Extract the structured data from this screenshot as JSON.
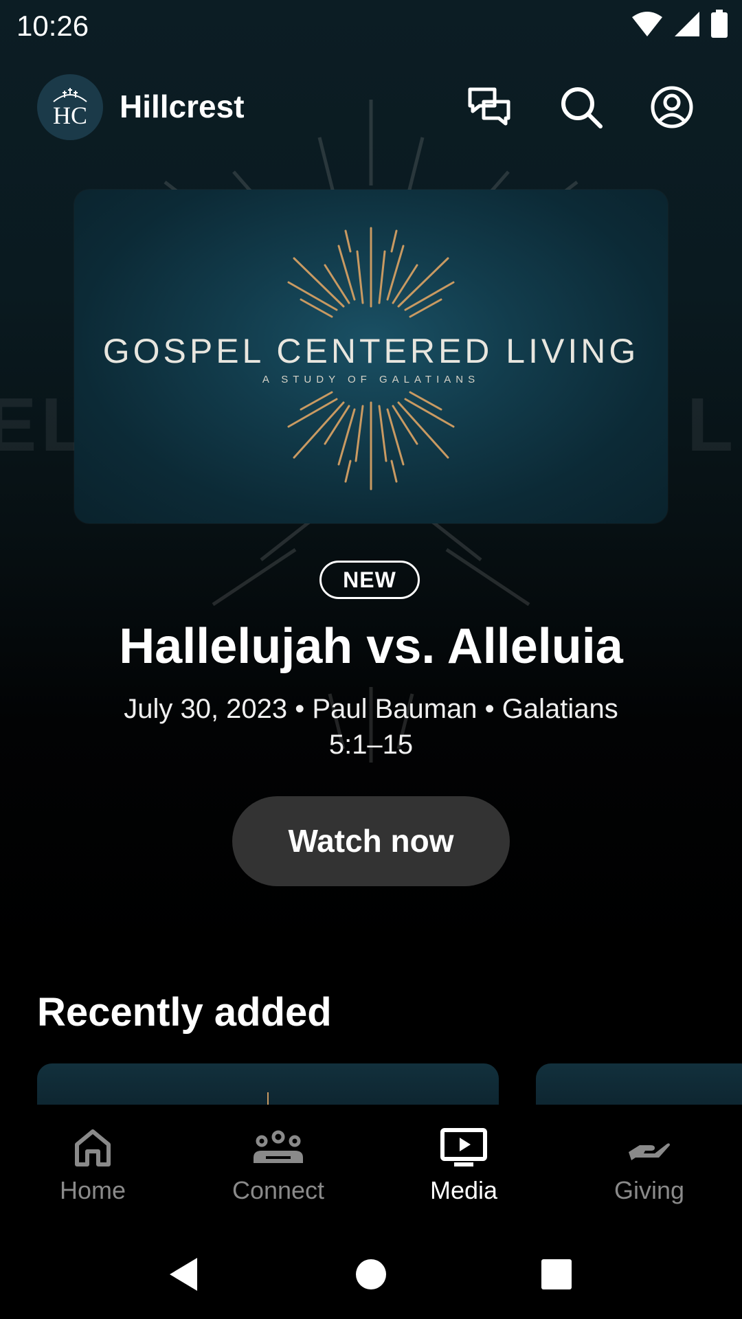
{
  "status_bar": {
    "time": "10:26",
    "icons": [
      "wifi-icon",
      "signal-icon",
      "battery-icon"
    ]
  },
  "header": {
    "logo_text": "HC",
    "title": "Hillcrest",
    "icons": [
      "chat-icon",
      "search-icon",
      "account-icon"
    ]
  },
  "hero": {
    "series_title": "GOSPEL CENTERED LIVING",
    "series_subtitle": "A STUDY OF GALATIANS",
    "background_text_left": "EL",
    "background_text_right": "L",
    "badge": "NEW",
    "sermon_title": "Hallelujah vs. Alleluia",
    "meta": "July 30, 2023 • Paul Bauman • Galatians 5:1–15",
    "watch_button": "Watch now"
  },
  "recently_added": {
    "title": "Recently added"
  },
  "bottom_nav": {
    "items": [
      {
        "label": "Home",
        "icon": "home-icon",
        "active": false
      },
      {
        "label": "Connect",
        "icon": "people-icon",
        "active": false
      },
      {
        "label": "Media",
        "icon": "tv-play-icon",
        "active": true
      },
      {
        "label": "Giving",
        "icon": "giving-hand-icon",
        "active": false
      }
    ]
  },
  "system_nav": [
    "back-icon",
    "home-circle-icon",
    "recents-icon"
  ],
  "colors": {
    "accent_gold": "#c99a62",
    "card_teal": "#134252",
    "button_gray": "#333333"
  }
}
